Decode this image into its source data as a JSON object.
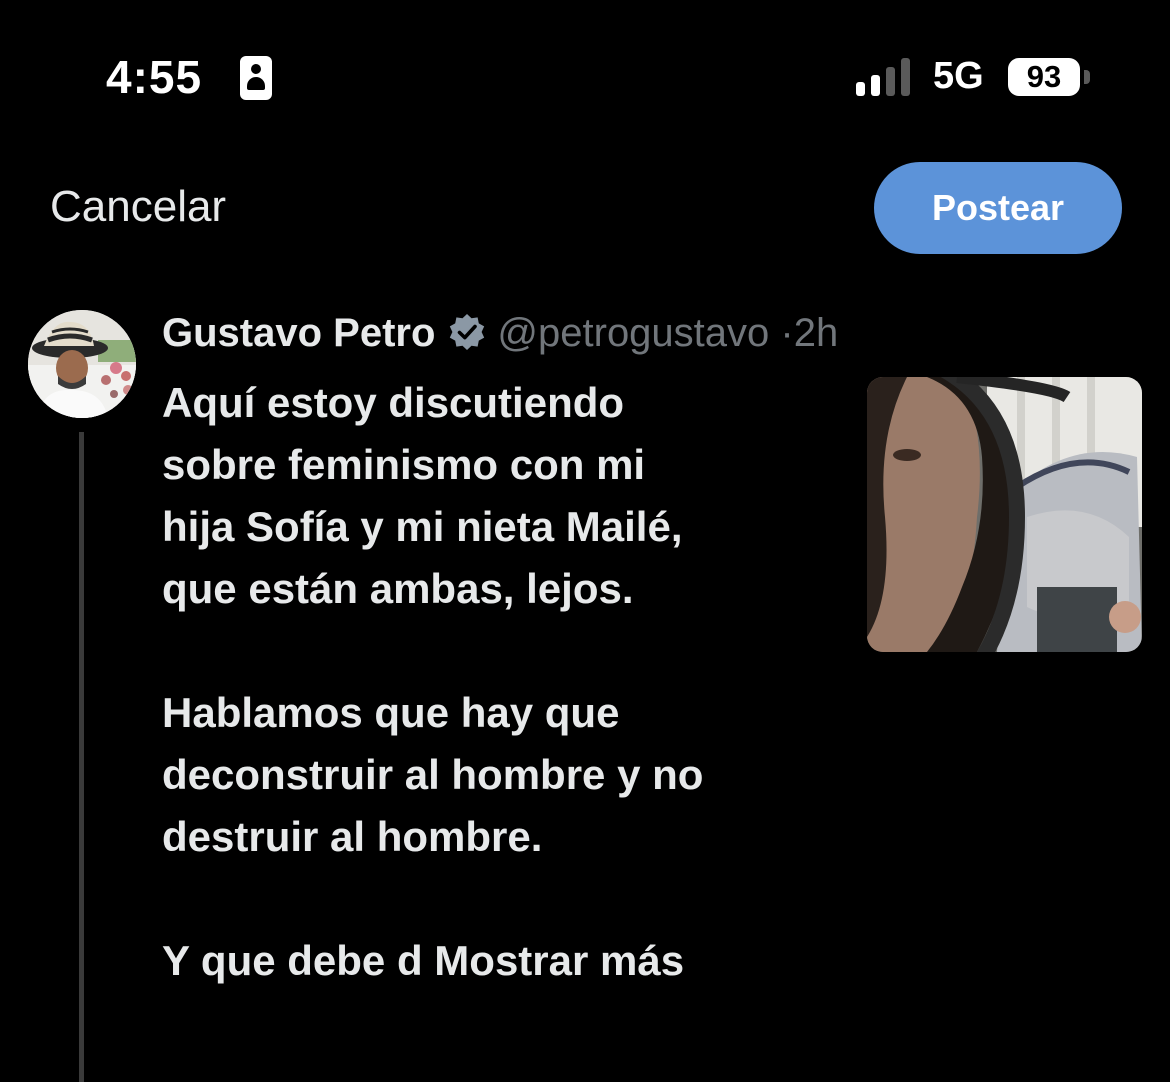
{
  "status_bar": {
    "time": "4:55",
    "network": "5G",
    "battery": "93",
    "icons": {
      "focus": "person-badge-icon",
      "signal": "cellular-signal-icon",
      "battery": "battery-icon"
    }
  },
  "composer": {
    "cancel_label": "Cancelar",
    "post_label": "Postear",
    "post_color": "#5c93d9"
  },
  "tweet": {
    "author": "Gustavo Petro",
    "handle": "@petrogustavo",
    "separator": "·",
    "age": "2h",
    "verified_icon": "verified-badge-icon",
    "paragraphs": [
      "Aquí estoy discutiendo\nsobre feminismo con mi\nhija Sofía y mi nieta Mailé,\nque están ambas, lejos.",
      "Hablamos que hay que\ndeconstruir al hombre y no\ndestruir al hombre."
    ],
    "last_line": "Y que debe d",
    "show_more": "Mostrar más"
  }
}
